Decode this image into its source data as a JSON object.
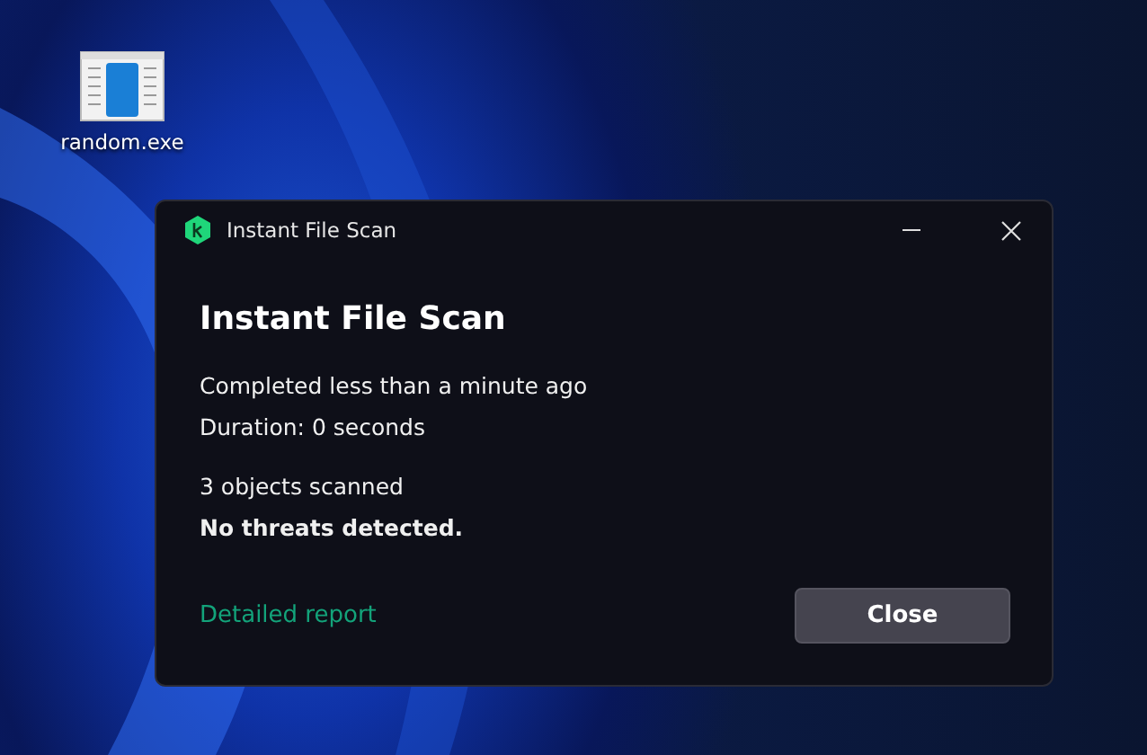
{
  "desktop_icons": [
    {
      "label": "random.exe"
    }
  ],
  "window": {
    "title": "Instant File Scan",
    "heading": "Instant File Scan",
    "groups": [
      [
        {
          "text": "Completed less than a minute ago",
          "strong": false
        },
        {
          "text": "Duration: 0 seconds",
          "strong": false
        }
      ],
      [
        {
          "text": "3 objects scanned",
          "strong": false
        },
        {
          "text": "No threats detected.",
          "strong": true
        }
      ]
    ],
    "link": "Detailed report",
    "button": "Close"
  }
}
